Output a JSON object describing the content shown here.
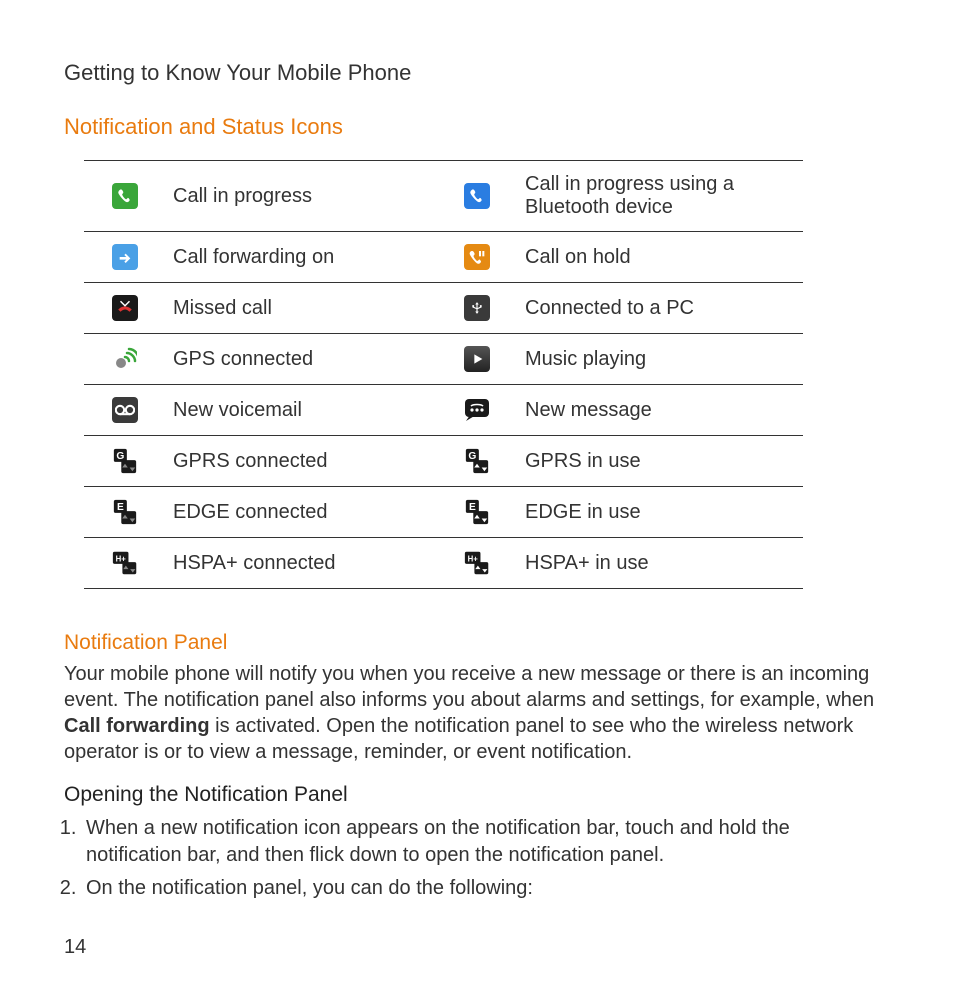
{
  "breadcrumb": "Getting to Know Your Mobile Phone",
  "section_title": "Notification and Status Icons",
  "icons": {
    "rows": [
      {
        "left_label": "Call in progress",
        "right_label": "Call in progress using a Bluetooth device"
      },
      {
        "left_label": "Call forwarding on",
        "right_label": "Call on hold"
      },
      {
        "left_label": "Missed call",
        "right_label": "Connected to a PC"
      },
      {
        "left_label": "GPS connected",
        "right_label": "Music playing"
      },
      {
        "left_label": "New voicemail",
        "right_label": "New message"
      },
      {
        "left_label": "GPRS connected",
        "right_label": "GPRS in use"
      },
      {
        "left_label": "EDGE connected",
        "right_label": "EDGE in use"
      },
      {
        "left_label": "HSPA+ connected",
        "right_label": "HSPA+ in use"
      }
    ]
  },
  "panel": {
    "title": "Notification Panel",
    "text_before": "Your mobile phone will notify you when you receive a new message or there is an incoming event. The notification panel also informs you about alarms and settings, for example, when ",
    "bold": "Call forwarding",
    "text_after": " is activated. Open the notification panel to see who the wireless network operator is or to view a message, reminder, or event notification.",
    "opening_title": "Opening the Notification Panel",
    "steps": [
      "When a new notification icon appears on the notification bar, touch and hold the notification bar, and then flick down to open the notification panel.",
      "On the notification panel, you can do the following:"
    ]
  },
  "page_number": "14"
}
